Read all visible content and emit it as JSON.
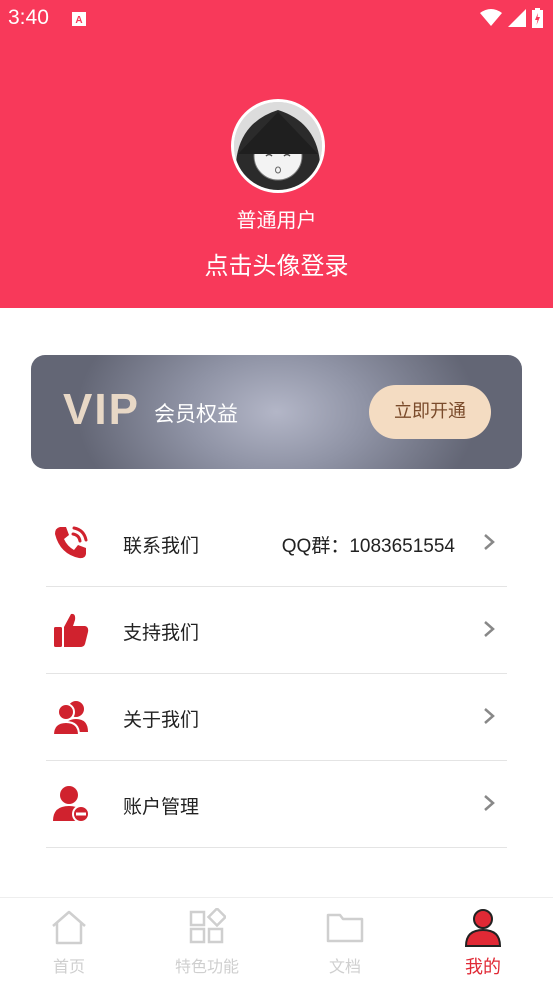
{
  "status_bar": {
    "time": "3:40"
  },
  "profile": {
    "username": "普通用户",
    "login_hint": "点击头像登录"
  },
  "vip": {
    "logo": "VIP",
    "title": "会员权益",
    "button": "立即开通"
  },
  "menu": [
    {
      "label": "联系我们",
      "value": "QQ群：1083651554",
      "icon": "phone-icon"
    },
    {
      "label": "支持我们",
      "value": "",
      "icon": "thumbs-up-icon"
    },
    {
      "label": "关于我们",
      "value": "",
      "icon": "users-icon"
    },
    {
      "label": "账户管理",
      "value": "",
      "icon": "user-remove-icon"
    }
  ],
  "nav": [
    {
      "label": "首页",
      "icon": "home-icon",
      "active": false
    },
    {
      "label": "特色功能",
      "icon": "apps-icon",
      "active": false
    },
    {
      "label": "文档",
      "icon": "folder-icon",
      "active": false
    },
    {
      "label": "我的",
      "icon": "person-icon",
      "active": true
    }
  ],
  "colors": {
    "primary": "#f8395a",
    "accent": "#e02935",
    "vip_button": "#f4dcc2"
  }
}
